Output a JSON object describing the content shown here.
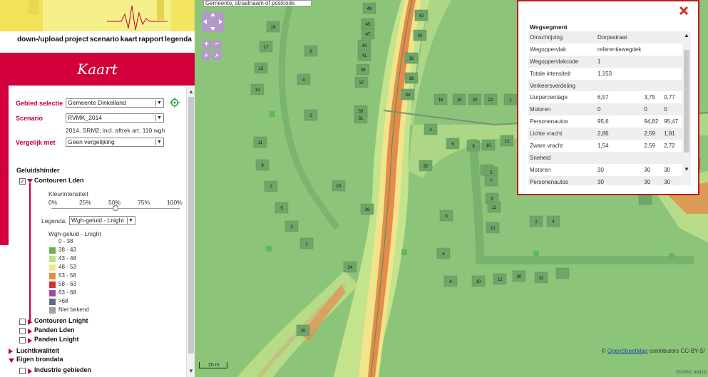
{
  "nav": {
    "items": [
      "down-/upload",
      "project",
      "scenario",
      "kaart",
      "rapport",
      "legenda"
    ]
  },
  "kaart_title": "Kaart",
  "selection": {
    "gebied_label": "Gebied selectie",
    "gebied_value": "Gemeente Dinkelland",
    "scenario_label": "Scenario",
    "scenario_value": "RVMK_2014",
    "scenario_desc": "2014, SRM2, incl. aftrek art. 110 wgh",
    "vergelijk_label": "Vergelijk met",
    "vergelijk_value": "Geen vergelijking"
  },
  "layers": {
    "geluidshinder": "Geluidshinder",
    "contouren_lden": "Contouren Lden",
    "kleurintensiteit": "Kleurintensiteit",
    "ticks": [
      "0%",
      "25%",
      "50%",
      "75%",
      "100%"
    ],
    "intensity_fraction": 0.5,
    "legenda_label": "Legenda:",
    "legenda_value": "Wgh-geluid - Lnight",
    "legend_title": "Wgh-geluid - Lnight",
    "legend_items": [
      {
        "label": "0 - 38",
        "color": "#ffffff"
      },
      {
        "label": "38 - 43",
        "color": "#6ab04c"
      },
      {
        "label": "43 - 48",
        "color": "#b6e28a"
      },
      {
        "label": "48 - 53",
        "color": "#f3e98a"
      },
      {
        "label": "53 - 58",
        "color": "#ee8a3a"
      },
      {
        "label": "58 - 63",
        "color": "#d9302a"
      },
      {
        "label": "63 - 68",
        "color": "#a04aa0"
      },
      {
        "label": ">68",
        "color": "#5a7080"
      },
      {
        "label": "Niet bekend",
        "color": "#a0a0a0"
      }
    ],
    "contouren_lnight": "Contouren Lnight",
    "panden_lden": "Panden Lden",
    "panden_lnight": "Panden Lnight",
    "luchtkwaliteit": "Luchtkwaliteit",
    "eigen_brondata": "Eigen brondata",
    "industrie": "Industrie gebieden"
  },
  "map": {
    "search_placeholder": "Gemeente, straatnaam of postcode",
    "scale_label": "20 m",
    "attribution_prefix": "©",
    "attribution_link": "OpenStreetMap",
    "attribution_suffix": "contributors CC-BY-S/",
    "coords": "262960, 48418",
    "house_numbers": [
      "49",
      "45",
      "47",
      "43",
      "41",
      "39",
      "37",
      "33",
      "31",
      "19",
      "17",
      "15",
      "13",
      "6",
      "4",
      "2",
      "11",
      "9",
      "7",
      "5",
      "3",
      "1",
      "23",
      "26",
      "24",
      "20",
      "42",
      "40",
      "38",
      "36",
      "34",
      "32",
      "4",
      "6",
      "8",
      "10",
      "12",
      "14",
      "16",
      "18",
      "20",
      "22",
      "1",
      "3",
      "5",
      "7",
      "9",
      "11",
      "13",
      "2",
      "4",
      "6",
      "8",
      "10",
      "12",
      "30",
      "32"
    ]
  },
  "popup": {
    "title": "Wegsegment",
    "rows": [
      [
        "Omschrijving",
        "Dorpsstraat",
        "",
        ""
      ],
      [
        "Wegoppervlak",
        "referentiewegdek",
        "",
        ""
      ],
      [
        "Wegoppervlakcode",
        "1",
        "",
        ""
      ],
      [
        "Totale intensiteit",
        "1.153",
        "",
        ""
      ],
      [
        "Verkeersverdeling",
        "",
        "",
        ""
      ],
      [
        "Uurpercentage",
        "6,57",
        "3,75",
        "0,77"
      ],
      [
        "Motoren",
        "0",
        "0",
        "0"
      ],
      [
        "Personenautos",
        "95,6",
        "94,82",
        "95,47"
      ],
      [
        "Lichte vracht",
        "2,86",
        "2,59",
        "1,81"
      ],
      [
        "Zware vracht",
        "1,54",
        "2,59",
        "2,72"
      ],
      [
        "Sneheid",
        "",
        "",
        ""
      ],
      [
        "Motoren",
        "30",
        "30",
        "30"
      ],
      [
        "Personenautos",
        "30",
        "30",
        "30"
      ]
    ]
  }
}
